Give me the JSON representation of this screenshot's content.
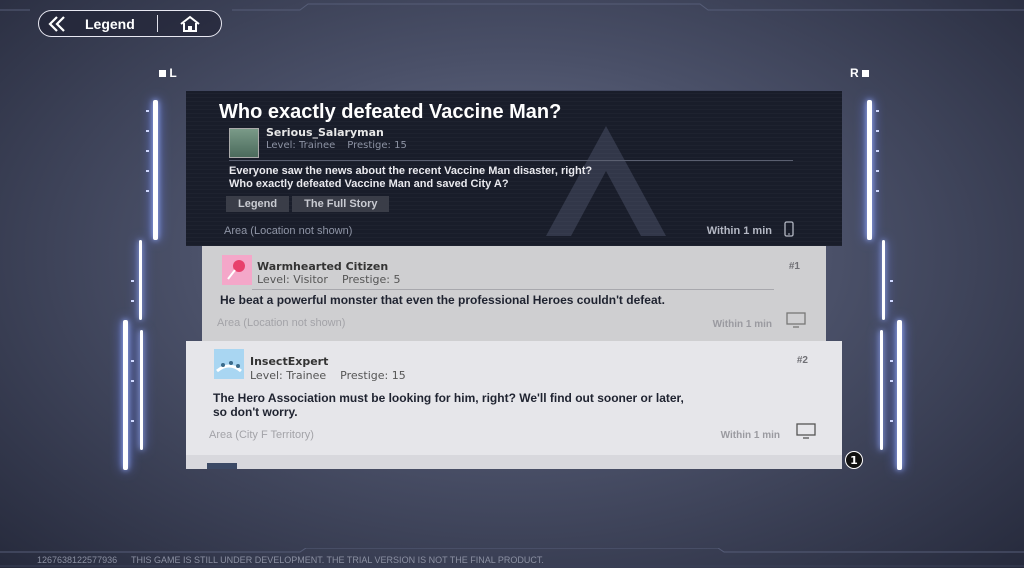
{
  "header": {
    "back_label": "Legend"
  },
  "sides": {
    "left": "L",
    "right": "R"
  },
  "post": {
    "title": "Who exactly defeated Vaccine Man?",
    "author": "Serious_Salaryman",
    "level": "Level: Trainee",
    "prestige": "Prestige: 15",
    "body_line1": "Everyone saw the news about the recent Vaccine Man disaster, right?",
    "body_line2": "Who exactly defeated Vaccine Man and saved City A?",
    "tags": [
      "Legend",
      "The Full Story"
    ],
    "area": "Area (Location not shown)",
    "time": "Within 1 min"
  },
  "replies": [
    {
      "number": "#1",
      "author": "Warmhearted Citizen",
      "level": "Level: Visitor",
      "prestige": "Prestige: 5",
      "body_line1": "He beat a powerful monster that even the professional Heroes couldn't defeat.",
      "area": "Area (Location not shown)",
      "time": "Within 1 min"
    },
    {
      "number": "#2",
      "author": "InsectExpert",
      "level": "Level: Trainee",
      "prestige": "Prestige: 15",
      "body_line1": "The Hero Association must be looking for him, right? We'll find out sooner or later,",
      "body_line2": "so don't worry.",
      "area": "Area (City F Territory)",
      "time": "Within 1 min"
    }
  ],
  "scroll_badge": "1",
  "footer": {
    "uid": "1267638122577936",
    "notice": "THIS GAME IS STILL UNDER DEVELOPMENT. THE TRIAL VERSION IS NOT THE FINAL PRODUCT."
  },
  "colors": {
    "post_bg": "#191d2a",
    "reply1_bg": "#cfcfd1",
    "reply2_bg": "#e6e6ea",
    "neon": "#ffffff",
    "neon_glow": "#6d86ff"
  }
}
